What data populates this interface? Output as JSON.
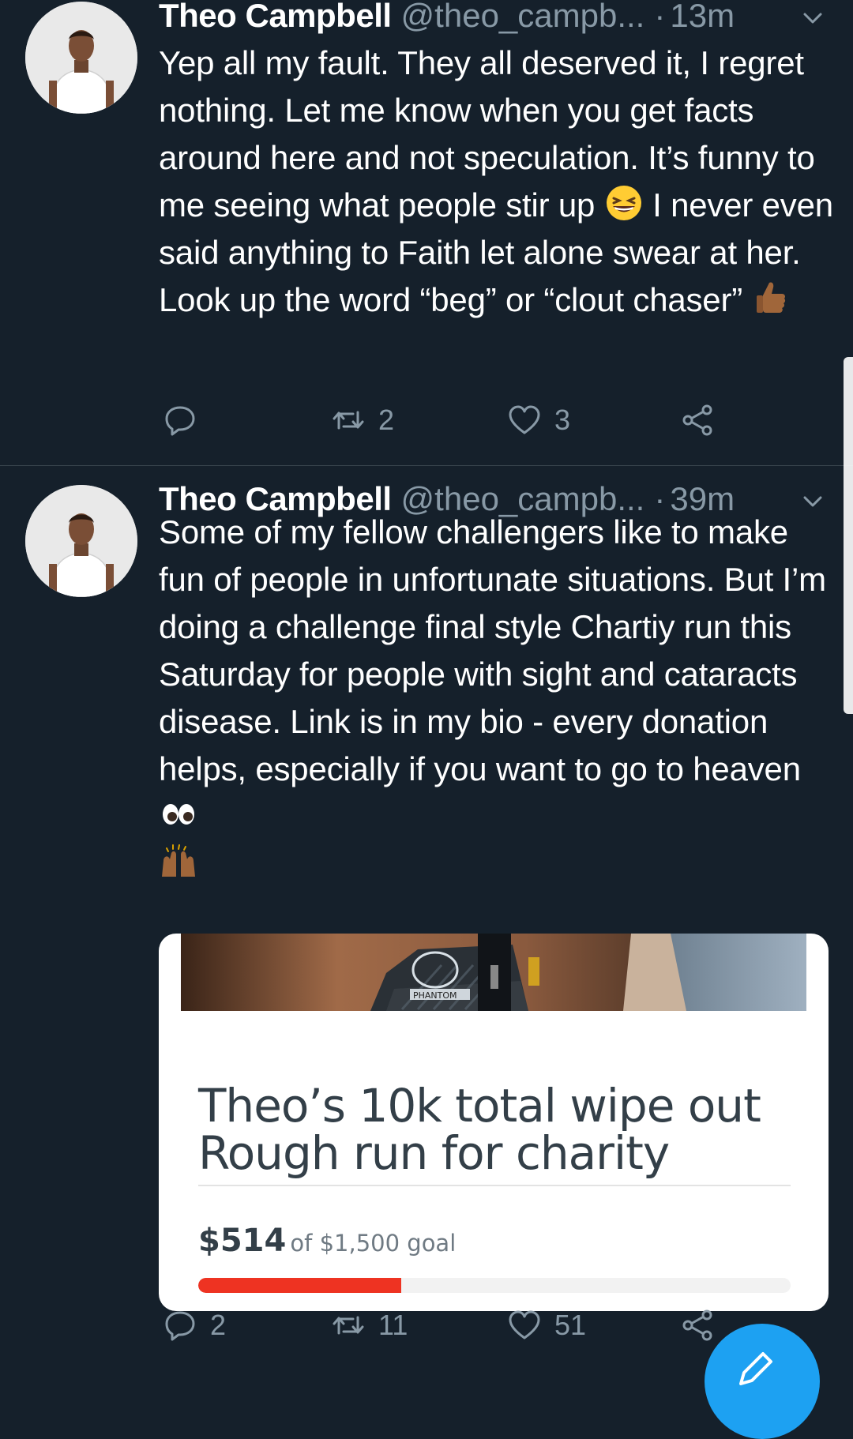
{
  "theme": {
    "background": "#15202b",
    "secondary_text": "#8899a6",
    "divider": "#38444d",
    "accent": "#1da1f2",
    "progress_color": "#ee3322"
  },
  "tweets": [
    {
      "author_name": "Theo Campbell",
      "handle": "@theo_campb...",
      "separator": "·",
      "time": "13m",
      "avatar_icon": "profile-photo",
      "text": {
        "part1": "Yep all my fault. They all deserved it, I regret nothing. Let me know when you get facts around here and not speculation. It’s funny to me seeing what people stir up ",
        "emoji1": "grinning-squinting-face-emoji",
        "part2": " I never even said anything to Faith let alone swear at her. Look up the word “beg” or “clout chaser” ",
        "emoji2": "thumbs-up-emoji"
      },
      "actions": {
        "reply_count": "",
        "retweet_count": "2",
        "like_count": "3"
      }
    },
    {
      "author_name": "Theo Campbell",
      "handle": "@theo_campb...",
      "separator": "·",
      "time": "39m",
      "avatar_icon": "profile-photo",
      "text": {
        "part1": "Some of my fellow challengers like to make fun of people in unfortunate situations. But I’m doing a challenge final style Chartiy run this Saturday for people with sight and cataracts disease. Link is in my bio - every donation helps, especially if you want to go to heaven ",
        "emoji1": "eyes-emoji",
        "emoji2": "raising-hands-emoji"
      },
      "card": {
        "image_caption_icon": "phantom-wetsuit-photo",
        "image_logo_text": "PHANTOM",
        "title_line1": "Theo’s 10k total wipe out",
        "title_line2": "Rough run for charity",
        "raised": "$514",
        "goal_text": "of $1,500 goal",
        "progress_fraction": 0.343
      },
      "actions": {
        "reply_count": "2",
        "retweet_count": "11",
        "like_count": "51"
      }
    }
  ],
  "fab_icon": "compose-tweet-icon"
}
